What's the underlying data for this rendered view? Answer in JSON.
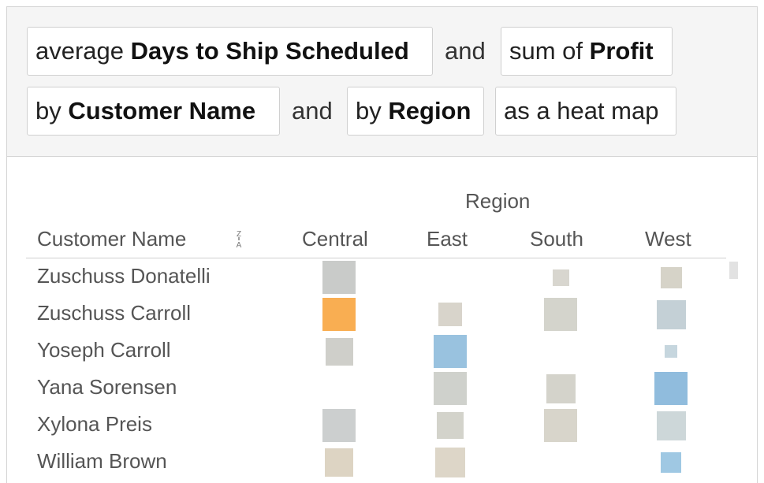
{
  "query": {
    "pill1_pre": "average",
    "pill1_bold": "Days to Ship Scheduled",
    "and1": "and",
    "pill2_pre": "sum of",
    "pill2_bold": "Profit",
    "pill3_pre": "by",
    "pill3_bold": "Customer Name",
    "and2": "and",
    "pill4_pre": "by",
    "pill4_bold": "Region",
    "pill5": "as a heat map"
  },
  "table": {
    "region_title": "Region",
    "customer_header": "Customer Name",
    "columns": [
      "Central",
      "East",
      "South",
      "West"
    ],
    "rows": [
      {
        "name": "Zuschuss Donatelli",
        "cells": [
          {
            "color": "#c9cbc9",
            "size": 1.0
          },
          null,
          {
            "color": "#d8d6cf",
            "size": 0.5
          },
          {
            "color": "#d6d3c8",
            "size": 0.64
          }
        ]
      },
      {
        "name": "Zuschuss Carroll",
        "cells": [
          {
            "color": "#f9ae52",
            "size": 1.0
          },
          {
            "color": "#d8d4cb",
            "size": 0.71
          },
          {
            "color": "#d4d4cc",
            "size": 1.0
          },
          {
            "color": "#c4d0d6",
            "size": 0.88
          }
        ]
      },
      {
        "name": "Yoseph Carroll",
        "cells": [
          {
            "color": "#cfcfca",
            "size": 0.83
          },
          {
            "color": "#99c2df",
            "size": 1.0
          },
          null,
          {
            "color": "#c6d6de",
            "size": 0.38
          }
        ]
      },
      {
        "name": "Yana Sorensen",
        "cells": [
          null,
          {
            "color": "#cfd1cc",
            "size": 1.0
          },
          {
            "color": "#d4d3cb",
            "size": 0.88
          },
          {
            "color": "#90bcdd",
            "size": 1.0
          }
        ]
      },
      {
        "name": "Xylona Preis",
        "cells": [
          {
            "color": "#cccfcf",
            "size": 1.0
          },
          {
            "color": "#d3d3cb",
            "size": 0.81
          },
          {
            "color": "#d8d5cb",
            "size": 1.0
          },
          {
            "color": "#cdd7d9",
            "size": 0.88
          }
        ]
      },
      {
        "name": "William Brown",
        "cells": [
          {
            "color": "#ddd4c3",
            "size": 0.86
          },
          {
            "color": "#ddd6c8",
            "size": 0.9
          },
          null,
          {
            "color": "#9fc8e3",
            "size": 0.62
          }
        ]
      }
    ]
  },
  "icons": {
    "sort": "sort-alpha-icon"
  }
}
